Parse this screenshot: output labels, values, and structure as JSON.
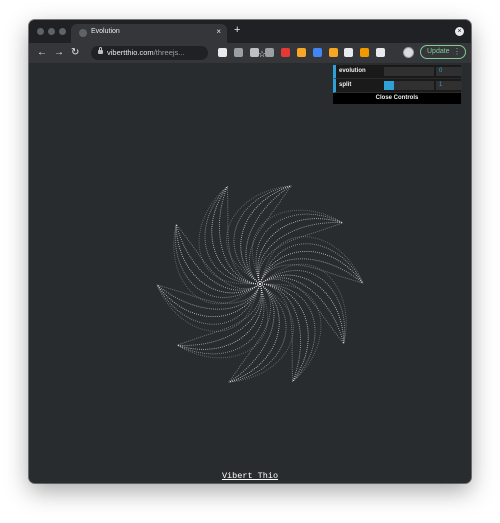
{
  "browser": {
    "tab": {
      "title": "Evolution",
      "close_icon": "×"
    },
    "new_tab_icon": "+",
    "window_menu_icon": "×",
    "nav": {
      "back_icon": "←",
      "forward_icon": "→",
      "reload_icon": "↻"
    },
    "url": {
      "host": "vibertthio.com",
      "path": "/threejs..."
    },
    "bookmark_icon": "☆",
    "extensions": [
      {
        "name": "ext-1-icon",
        "color": "#e8eaed"
      },
      {
        "name": "ext-2-icon",
        "color": "#9aa0a6"
      },
      {
        "name": "ext-3-icon",
        "color": "#bdc1c6"
      },
      {
        "name": "ext-4-icon",
        "color": "#9aa0a6"
      },
      {
        "name": "ext-5-icon",
        "color": "#e53935"
      },
      {
        "name": "ext-6-icon",
        "color": "#f9a825"
      },
      {
        "name": "ext-7-icon",
        "color": "#4285f4"
      },
      {
        "name": "ext-8-icon",
        "color": "#f6a623"
      },
      {
        "name": "ext-9-icon",
        "color": "#e8eaed"
      },
      {
        "name": "ext-10-icon",
        "color": "#f29900"
      },
      {
        "name": "puzzle-icon",
        "color": "#e8eaed"
      }
    ],
    "update": {
      "label": "Update",
      "menu_icon": "⋮",
      "color": "#81c995"
    }
  },
  "gui": {
    "controls": [
      {
        "name": "evolution",
        "value": "0",
        "fill": 0
      },
      {
        "name": "split",
        "value": "1",
        "fill": 0.2
      }
    ],
    "close_label": "Close Controls",
    "accent": "#2fa1d6"
  },
  "scene": {
    "background": "#282c2e",
    "petals": 10
  },
  "credit": "Vibert Thio"
}
